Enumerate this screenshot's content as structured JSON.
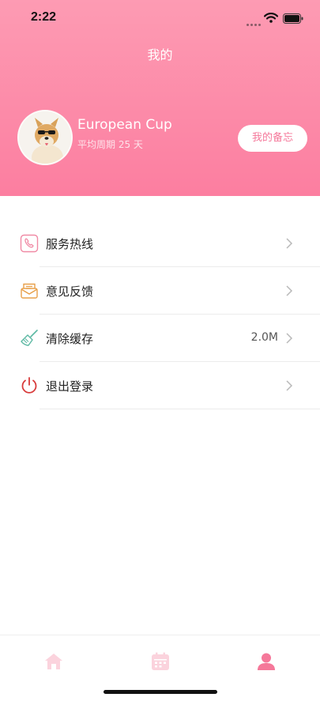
{
  "status_bar": {
    "time": "2:22"
  },
  "header": {
    "title": "我的",
    "username": "European Cup",
    "period_text": "平均周期 25 天",
    "memo_button": "我的备忘"
  },
  "menu": {
    "items": [
      {
        "label": "服务热线",
        "value": "",
        "icon": "phone-icon"
      },
      {
        "label": "意见反馈",
        "value": "",
        "icon": "mail-icon"
      },
      {
        "label": "清除缓存",
        "value": "2.0M",
        "icon": "broom-icon"
      },
      {
        "label": "退出登录",
        "value": "",
        "icon": "power-icon"
      }
    ]
  },
  "tabbar": {
    "tabs": [
      {
        "icon": "home-icon",
        "active": false
      },
      {
        "icon": "calendar-icon",
        "active": false
      },
      {
        "icon": "profile-icon",
        "active": true
      }
    ]
  },
  "colors": {
    "header_top": "#fd9bb3",
    "header_bottom": "#fc7ea0",
    "accent": "#f5789a",
    "tab_inactive": "#fbd3dd",
    "tab_active": "#f5789a"
  }
}
